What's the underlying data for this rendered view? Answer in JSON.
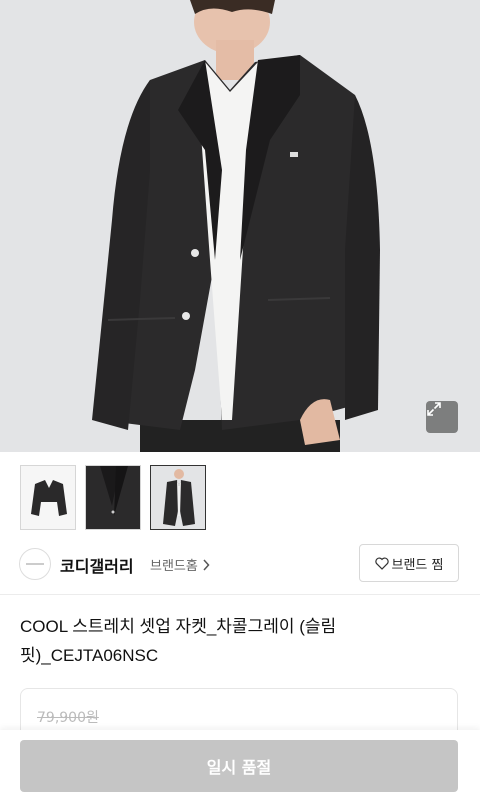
{
  "product": {
    "title": "COOL 스트레치 셋업 자켓_차콜그레이 (슬림핏)_CEJTA06NSC",
    "original_price": "79,900원",
    "main_image": "jacket-model-photo"
  },
  "gallery": {
    "thumbnails": [
      "jacket-flat",
      "jacket-detail",
      "jacket-model"
    ],
    "active_index": 2
  },
  "brand": {
    "name": "코디갤러리",
    "home_label": "브랜드홈",
    "like_label": "브랜드 찜"
  },
  "actions": {
    "soldout_label": "일시 품절"
  },
  "colors": {
    "soldout_bg": "#c5c5c5",
    "hero_bg": "#e3e4e6"
  }
}
